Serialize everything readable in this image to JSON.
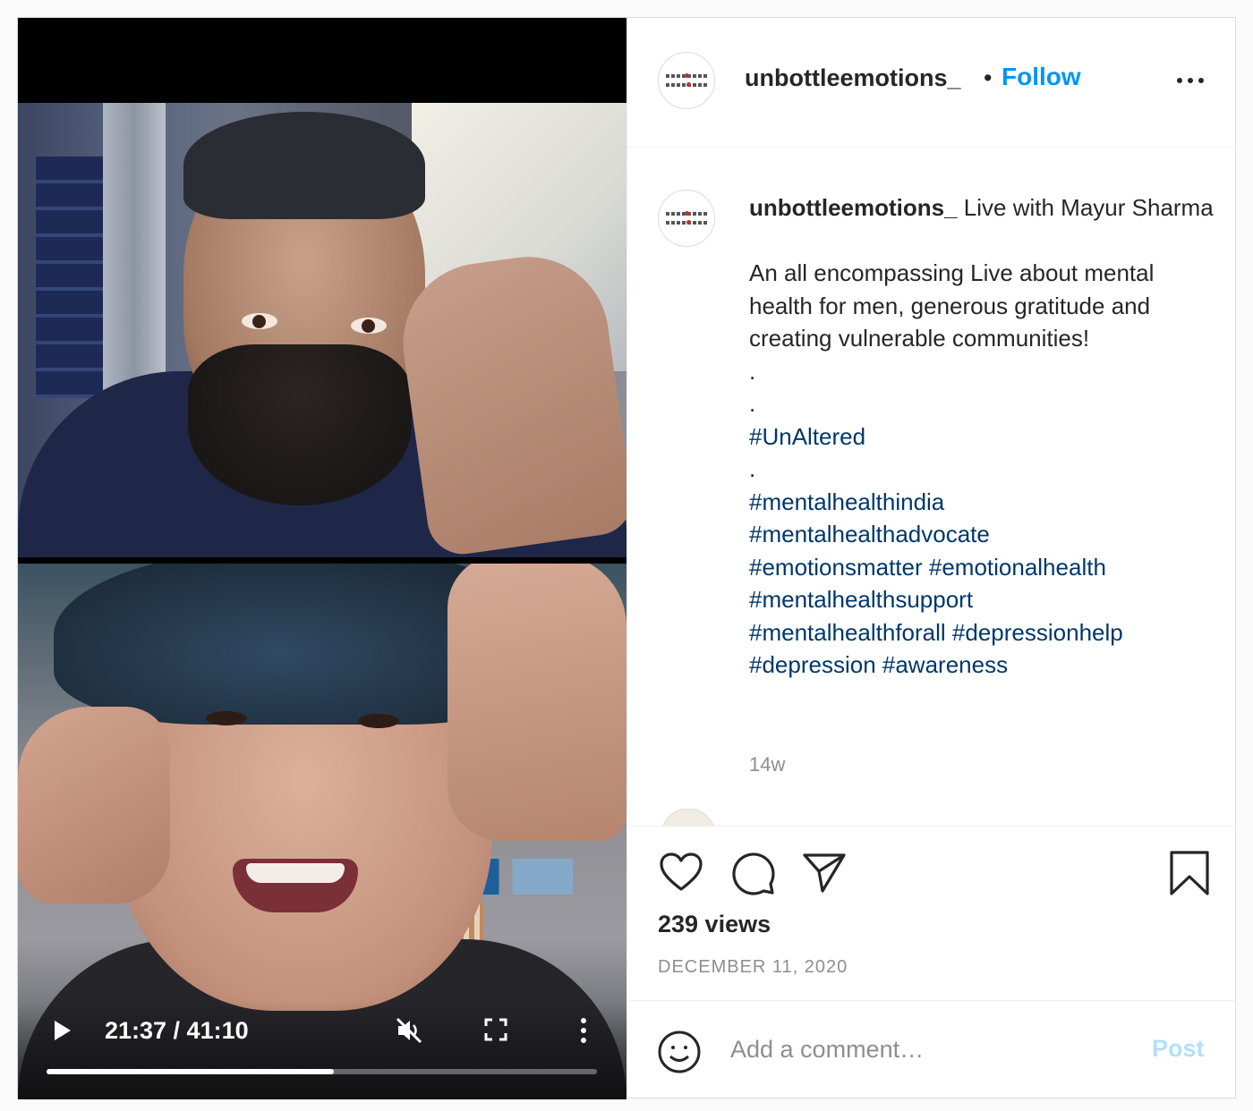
{
  "video": {
    "time_current": "21:37",
    "time_total": "41:10",
    "time_display": "21:37 / 41:10",
    "progress_fraction": 0.522,
    "icons": {
      "play": "play-icon",
      "mute": "volume-muted-icon",
      "fullscreen": "fullscreen-icon",
      "more": "more-vertical-icon"
    }
  },
  "header": {
    "username": "unbottleemotions_",
    "separator": "•",
    "follow_label": "Follow",
    "more_icon": "more-horizontal-icon"
  },
  "caption": {
    "username": "unbottleemotions_",
    "lines": [
      {
        "text": "Live with Mayur Sharma",
        "type": "text"
      },
      {
        "text": "",
        "type": "blank"
      },
      {
        "text": "An all encompassing Live about mental health for men, generous gratitude and creating vulnerable communities!",
        "type": "text"
      },
      {
        "text": ".",
        "type": "text"
      },
      {
        "text": ".",
        "type": "text"
      },
      {
        "text": "#UnAltered",
        "type": "tag"
      },
      {
        "text": ".",
        "type": "text"
      },
      {
        "text": "#mentalhealthindia",
        "type": "tag"
      },
      {
        "text": "#mentalhealthadvocate",
        "type": "tag"
      },
      {
        "text": "#emotionsmatter #emotionalhealth",
        "type": "tag"
      },
      {
        "text": "#mentalhealthsupport",
        "type": "tag"
      },
      {
        "text": "#mentalhealthforall #depressionhelp",
        "type": "tag"
      },
      {
        "text": "#depression #awareness",
        "type": "tag"
      }
    ],
    "age": "14w"
  },
  "actions": {
    "icons": [
      "heart-icon",
      "comment-icon",
      "share-icon",
      "bookmark-icon"
    ],
    "views": "239 views",
    "date": "DECEMBER 11, 2020"
  },
  "comment": {
    "placeholder": "Add a comment…",
    "post_label": "Post",
    "emoji_icon": "emoji-icon"
  },
  "colors": {
    "follow": "#0095f6",
    "hashtag": "#00376b",
    "post_disabled": "#b2dffc",
    "muted_text": "#8e8e8e"
  }
}
